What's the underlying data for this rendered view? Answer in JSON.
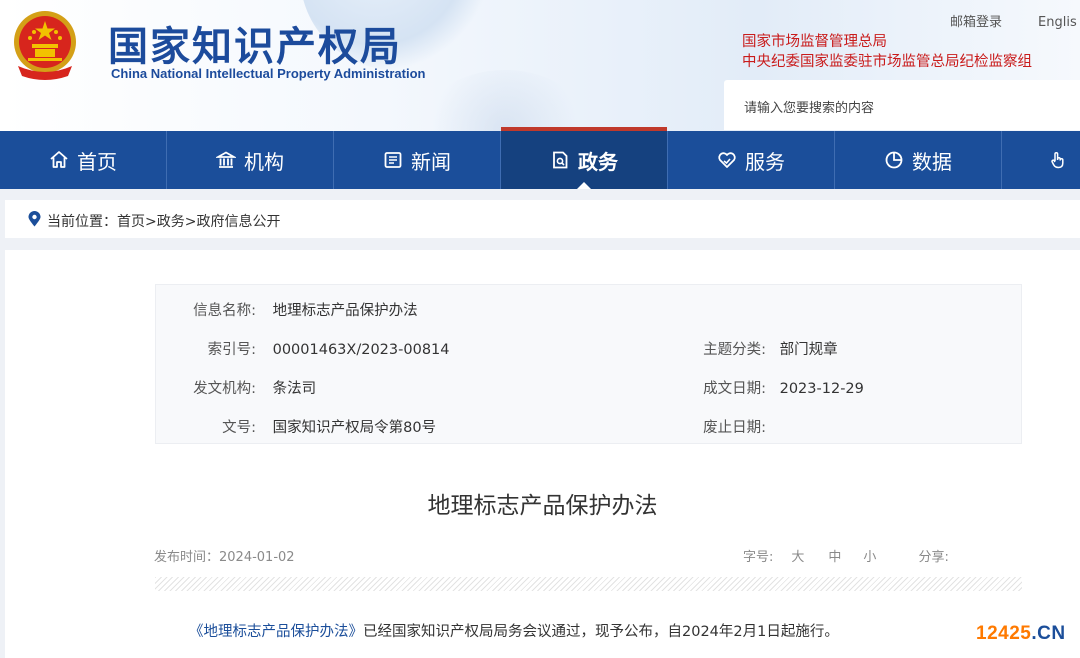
{
  "header": {
    "title_cn": "国家知识产权局",
    "title_en": "China National Intellectual Property Administration",
    "mail_login": "邮箱登录",
    "english_link": "Englis",
    "red_links": [
      "国家市场监督管理总局",
      "中央纪委国家监委驻市场监管总局纪检监察组"
    ],
    "search_placeholder": "请输入您要搜索的内容"
  },
  "nav": {
    "items": [
      {
        "label": "首页",
        "icon": "home-icon"
      },
      {
        "label": "机构",
        "icon": "institution-icon"
      },
      {
        "label": "新闻",
        "icon": "news-icon"
      },
      {
        "label": "政务",
        "icon": "government-affairs-icon",
        "active": true
      },
      {
        "label": "服务",
        "icon": "service-icon"
      },
      {
        "label": "数据",
        "icon": "data-icon"
      },
      {
        "label": "",
        "icon": "hand-icon"
      }
    ]
  },
  "breadcrumb": {
    "prefix": "当前位置：",
    "path": "首页>政务>政府信息公开"
  },
  "info_table": {
    "name_label": "信息名称:",
    "name_value": "地理标志产品保护办法",
    "index_label": "索引号:",
    "index_value": "00001463X/2023-00814",
    "topic_label": "主题分类:",
    "topic_value": "部门规章",
    "issuer_label": "发文机构:",
    "issuer_value": "条法司",
    "date_label": "成文日期:",
    "date_value": "2023-12-29",
    "doc_no_label": "文号:",
    "doc_no_value": "国家知识产权局令第80号",
    "expiry_label": "废止日期:",
    "expiry_value": ""
  },
  "article": {
    "title": "地理标志产品保护办法",
    "publish_time": "发布时间：2024-01-02",
    "font_size_label": "字号:",
    "size_large": "大",
    "size_medium": "中",
    "size_small": "小",
    "share_label": "分享:",
    "body_link": "《地理标志产品保护办法》",
    "body_rest": "已经国家知识产权局局务会议通过，现予公布，自2024年2月1日起施行。"
  },
  "watermark": {
    "number": "12425",
    "suffix": ".CN"
  },
  "colors": {
    "brand_blue": "#1b4e9a",
    "accent_red": "#c91b1b",
    "watermark_orange": "#ff7a00"
  }
}
